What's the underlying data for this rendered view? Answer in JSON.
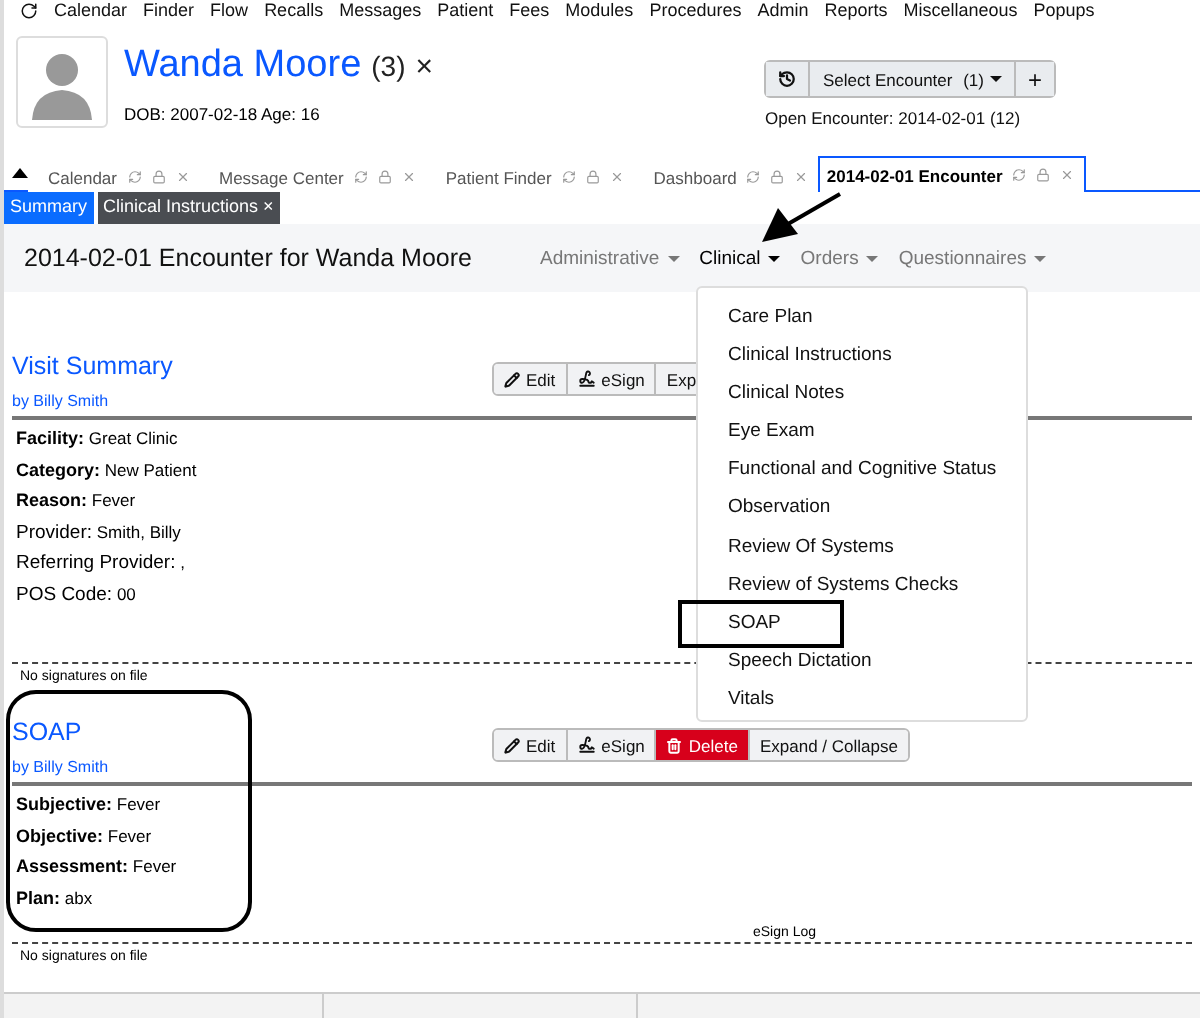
{
  "top_menu": [
    "Calendar",
    "Finder",
    "Flow",
    "Recalls",
    "Messages",
    "Patient",
    "Fees",
    "Modules",
    "Procedures",
    "Admin",
    "Reports",
    "Miscellaneous",
    "Popups"
  ],
  "patient": {
    "name": "Wanda Moore",
    "count": "(3)",
    "close": "×",
    "dob": "DOB: 2007-02-18 Age: 16"
  },
  "encounter_selector": {
    "label": "Select Encounter",
    "count": "(1)",
    "add": "+",
    "open_encounter": "Open Encounter: 2014-02-01 (12)"
  },
  "tabs": [
    {
      "label": "Calendar",
      "selected": false
    },
    {
      "label": "Message Center",
      "selected": false
    },
    {
      "label": "Patient Finder",
      "selected": false
    },
    {
      "label": "Dashboard",
      "selected": false
    },
    {
      "label": "2014-02-01 Encounter",
      "selected": true
    }
  ],
  "subtabs": [
    {
      "label": "Summary",
      "selected": true
    },
    {
      "label": "Clinical Instructions ×",
      "selected": false
    }
  ],
  "encounter_title": "2014-02-01 Encounter for Wanda Moore",
  "nav_menus": [
    {
      "label": "Administrative",
      "selected": false
    },
    {
      "label": "Clinical",
      "selected": true
    },
    {
      "label": "Orders",
      "selected": false
    },
    {
      "label": "Questionnaires",
      "selected": false
    }
  ],
  "dropdown_items": [
    "Care Plan",
    "Clinical Instructions",
    "Clinical Notes",
    "Eye Exam",
    "Functional and Cognitive Status",
    "Observation",
    "Review Of Systems",
    "Review of Systems Checks",
    "SOAP",
    "Speech Dictation",
    "Vitals"
  ],
  "sections": [
    {
      "title": "Visit Summary",
      "author": "by Billy Smith",
      "buttons": [
        {
          "label": "Edit",
          "kind": "edit"
        },
        {
          "label": "eSign",
          "kind": "esign"
        },
        {
          "label": "Exp",
          "kind": "plain"
        }
      ],
      "fields": [
        {
          "label": "Facility:",
          "value": "Great Clinic",
          "bold": true
        },
        {
          "label": "Category:",
          "value": "New Patient",
          "bold": true
        },
        {
          "label": "Reason:",
          "value": "Fever",
          "bold": true
        },
        {
          "label": "Provider:",
          "value": "Smith, Billy",
          "bold": false
        },
        {
          "label": "Referring Provider:",
          "value": ",",
          "bold": false
        },
        {
          "label": "POS Code:",
          "value": "00",
          "bold": false
        }
      ],
      "signatures": "No signatures on file"
    },
    {
      "title": "SOAP",
      "author": "by Billy Smith",
      "buttons": [
        {
          "label": "Edit",
          "kind": "edit"
        },
        {
          "label": "eSign",
          "kind": "esign"
        },
        {
          "label": "Delete",
          "kind": "delete"
        },
        {
          "label": "Expand / Collapse",
          "kind": "plain"
        }
      ],
      "fields": [
        {
          "label": "Subjective:",
          "value": "Fever",
          "bold": true
        },
        {
          "label": "Objective:",
          "value": "Fever",
          "bold": true
        },
        {
          "label": "Assessment:",
          "value": "Fever",
          "bold": true
        },
        {
          "label": "Plan:",
          "value": "abx",
          "bold": true
        }
      ],
      "esign_log": "eSign Log",
      "signatures": "No signatures on file"
    }
  ]
}
